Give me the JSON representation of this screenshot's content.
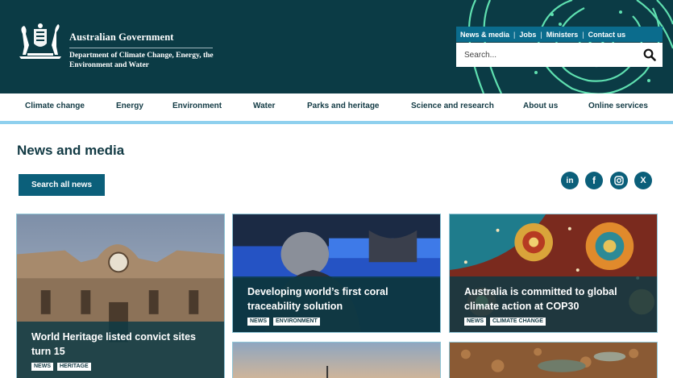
{
  "government": {
    "title": "Australian Government",
    "department": "Department of Climate Change, Energy, the Environment and Water"
  },
  "utility_links": [
    "News & media",
    "Jobs",
    "Ministers",
    "Contact us"
  ],
  "search": {
    "placeholder": "Search..."
  },
  "nav": {
    "items": [
      "Climate change",
      "Energy",
      "Environment",
      "Water",
      "Parks and heritage",
      "Science and research",
      "About us",
      "Online services"
    ]
  },
  "page": {
    "title": "News and media",
    "search_button": "Search all news"
  },
  "social": [
    {
      "name": "linkedin-icon",
      "glyph": "in"
    },
    {
      "name": "facebook-icon",
      "glyph": "f"
    },
    {
      "name": "instagram-icon",
      "glyph": ""
    },
    {
      "name": "x-icon",
      "glyph": "X"
    }
  ],
  "cards": [
    {
      "title": "World Heritage listed convict sites turn 15",
      "tags": [
        "NEWS",
        "HERITAGE"
      ]
    },
    {
      "title": "Developing world’s first coral traceability solution",
      "tags": [
        "NEWS",
        "ENVIRONMENT"
      ]
    },
    {
      "title": "Australia is committed to global climate action at COP30",
      "tags": [
        "NEWS",
        "CLIMATE CHANGE"
      ]
    },
    {
      "title": "",
      "tags": []
    },
    {
      "title": "",
      "tags": []
    }
  ],
  "colors": {
    "header_bg": "#0b3b45",
    "accent": "#0b5f7a",
    "utility_bar": "#0b6c8d",
    "nav_underline": "#8fd0ee",
    "header_art": "#5fe0b0"
  }
}
